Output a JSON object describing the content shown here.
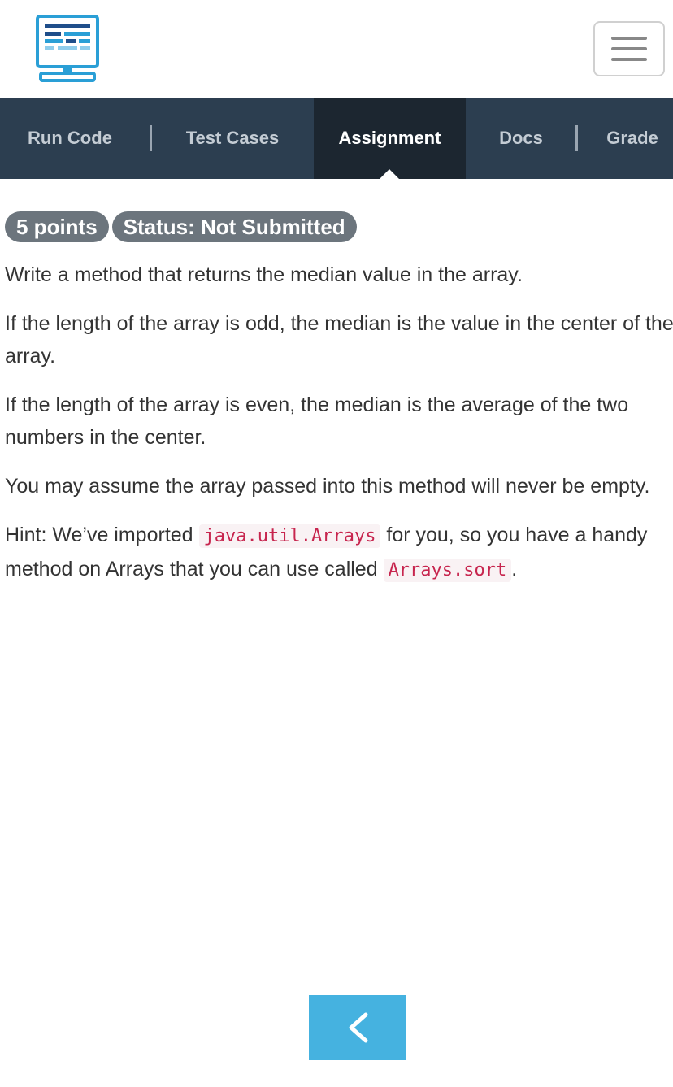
{
  "header": {
    "logo_icon": "computer-monitor-icon",
    "menu_icon": "hamburger-menu-icon"
  },
  "tabs": [
    {
      "label": "Run Code",
      "active": false
    },
    {
      "label": "Test Cases",
      "active": false
    },
    {
      "label": "Assignment",
      "active": true
    },
    {
      "label": "Docs",
      "active": false
    },
    {
      "label": "Grade",
      "active": false
    }
  ],
  "badges": {
    "points": "5 points",
    "status": "Status: Not Submitted"
  },
  "assignment": {
    "p1": "Write a method that returns the median value in the array.",
    "p2_line1": "If the length of the array is odd, the median is the value in the center of the",
    "p2_line2": "array.",
    "p3_line1": "If the length of the array is even, the median is the average of the two",
    "p3_line2": "numbers in the center.",
    "p4": "You may assume the array passed into this method will never be empty.",
    "hint_pre": "Hint: We’ve imported ",
    "hint_code1": "java.util.Arrays",
    "hint_mid": " for you, so you have a handy",
    "hint_line2_pre": "method on Arrays that you can use called ",
    "hint_code2": "Arrays.sort",
    "hint_end": "."
  },
  "footer": {
    "back_icon": "chevron-left-icon"
  },
  "colors": {
    "tabbar": "#2c3e50",
    "tab_active": "#1c2630",
    "badge": "#6c757d",
    "back_button": "#45b2e0",
    "logo": "#2a9fd6"
  }
}
